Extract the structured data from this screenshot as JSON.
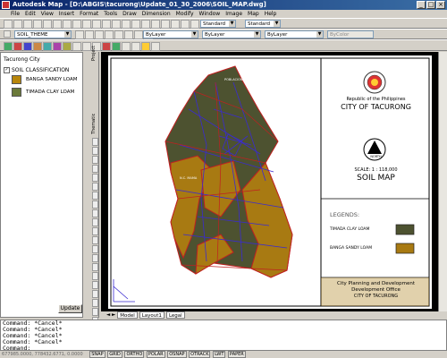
{
  "window": {
    "title": "Autodesk Map - [D:\\ABGIS\\tacurong\\Update_01_30_2006\\SOIL_MAP.dwg]"
  },
  "menu": [
    "File",
    "Edit",
    "View",
    "Insert",
    "Format",
    "Tools",
    "Draw",
    "Dimension",
    "Modify",
    "Window",
    "Image",
    "Map",
    "Help"
  ],
  "toolbar": {
    "text_style": "Standard",
    "dim_style": "Standard",
    "layer": "SOIL_THEME",
    "color": "ByLayer",
    "linetype": "ByLayer",
    "lineweight": "ByLayer",
    "plotstyle": "ByColor"
  },
  "display_manager": {
    "root": "Tacurong City",
    "theme": "SOIL CLASSIFICATION",
    "items": [
      {
        "label": "BANGA SANDY LOAM",
        "color": "#b8860b"
      },
      {
        "label": "TIMADA CLAY LOAM",
        "color": "#6b7a3a"
      }
    ],
    "update_button": "Update"
  },
  "side_tabs": {
    "project": "Project",
    "thematic": "Thematic"
  },
  "title_block": {
    "country": "Republic of the Philippines",
    "city": "CITY OF TACURONG",
    "north_label": "NORTH",
    "scale": "SCALE:  1 : 118,000",
    "map_title": "SOIL MAP",
    "legends_title": "LEGENDS:",
    "legend": [
      {
        "label": "TIMADA CLAY LOAM",
        "color": "#4d5230"
      },
      {
        "label": "BANGA SANDY LOAM",
        "color": "#a87a12"
      }
    ],
    "office_line1": "City Planning and Development",
    "office_line2": "Development Office",
    "office_line3": "CITY OF TACURONG"
  },
  "layout_tabs": [
    "Model",
    "Layout1",
    "Legal"
  ],
  "command_lines": [
    "Command: *Cancel*",
    "Command: *Cancel*",
    "Command: *Cancel*",
    "Command: *Cancel*",
    "Command:"
  ],
  "status": {
    "coords": "677985.0000, 778432.6771, 0.0000",
    "buttons": [
      "SNAP",
      "GRID",
      "ORTHO",
      "POLAR",
      "OSNAP",
      "OTRACK",
      "LWT",
      "PAPER"
    ]
  },
  "map_labels": {
    "poblacion": "POBLACION",
    "sw": "N.C. MAMA"
  }
}
